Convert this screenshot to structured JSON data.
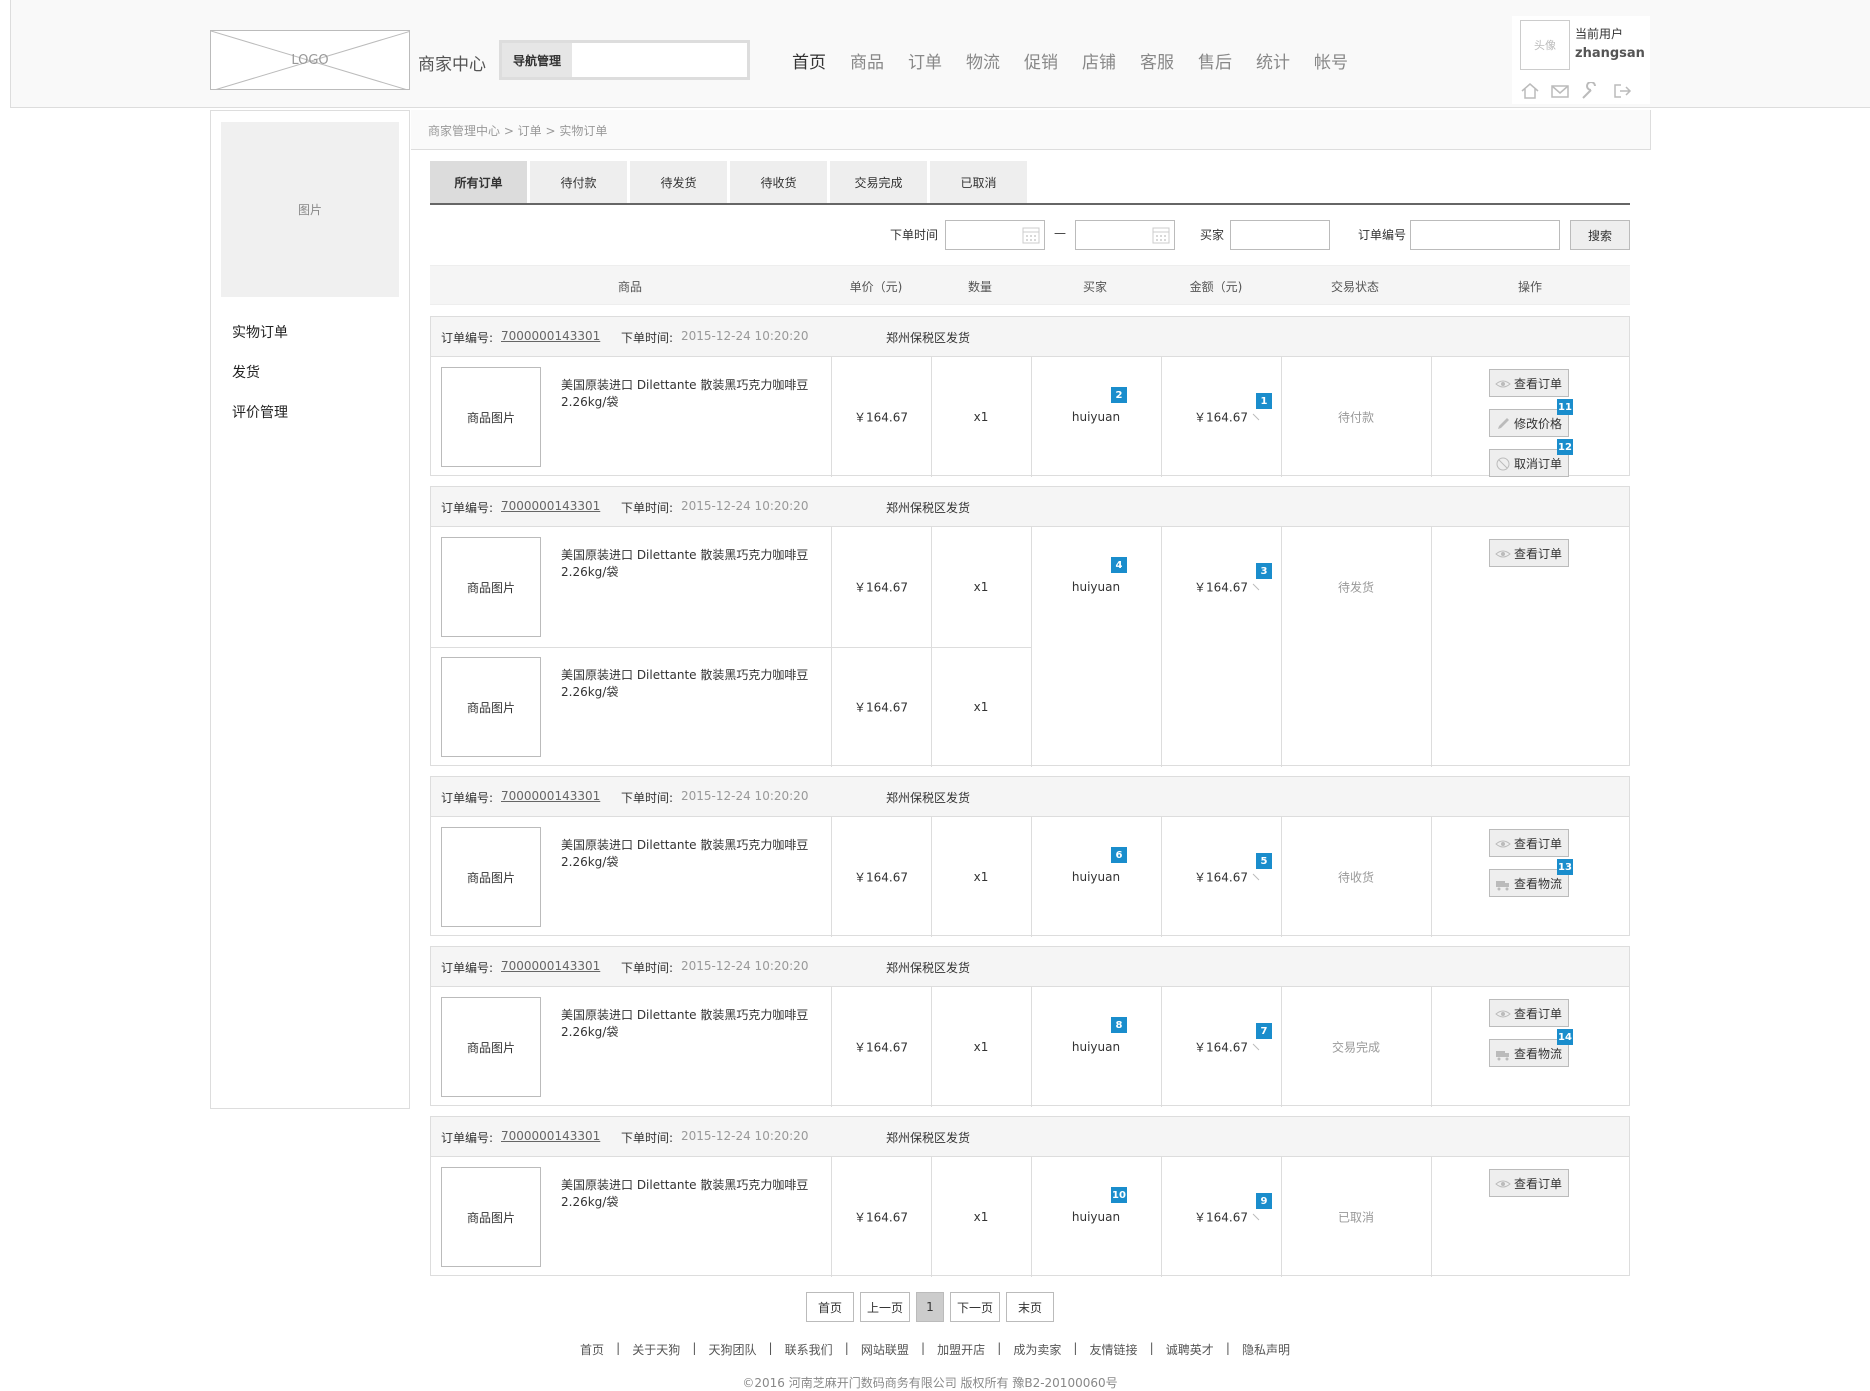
{
  "header": {
    "logo_text": "LOGO",
    "center_title": "商家中心",
    "nav_manage_label": "导航管理",
    "nav_items": [
      "首页",
      "商品",
      "订单",
      "物流",
      "促销",
      "店铺",
      "客服",
      "售后",
      "统计",
      "帐号"
    ],
    "avatar_text": "头像",
    "current_user_label": "当前用户",
    "username": "zhangsan"
  },
  "sidebar": {
    "picture_label": "图片",
    "items": [
      "实物订单",
      "发货",
      "评价管理"
    ]
  },
  "breadcrumb": "商家管理中心  > 订单 > 实物订单",
  "tabs": [
    "所有订单",
    "待付款",
    "待发货",
    "待收货",
    "交易完成",
    "已取消"
  ],
  "filter": {
    "order_time_label": "下单时间",
    "dash": "—",
    "buyer_label": "买家",
    "order_no_label": "订单编号",
    "search_label": "搜索"
  },
  "table_headers": [
    "商品",
    "单价（元)",
    "数量",
    "买家",
    "金额（元)",
    "交易状态",
    "操作"
  ],
  "order_labels": {
    "no_label": "订单编号:",
    "time_label": "下单时间:",
    "product_image": "商品图片"
  },
  "orders": [
    {
      "no": "7000000143301",
      "time": "2015-12-24 10:20:20",
      "warehouse": "郑州保税区发货",
      "products": [
        {
          "name1": "美国原装进口 Dilettante 散装黑巧克力咖啡豆",
          "name2": "2.26kg/袋",
          "price": "￥164.67",
          "qty": "x1"
        }
      ],
      "buyer": "huiyuan",
      "amount": "￥164.67",
      "status": "待付款",
      "buyer_badge": "2",
      "amount_badge": "1",
      "actions": [
        {
          "label": "查看订单",
          "icon": "eye-icon",
          "badge": ""
        },
        {
          "label": "修改价格",
          "icon": "pencil-icon",
          "badge": "11"
        },
        {
          "label": "取消订单",
          "icon": "cancel-icon",
          "badge": "12"
        }
      ]
    },
    {
      "no": "7000000143301",
      "time": "2015-12-24 10:20:20",
      "warehouse": "郑州保税区发货",
      "products": [
        {
          "name1": "美国原装进口 Dilettante 散装黑巧克力咖啡豆",
          "name2": "2.26kg/袋",
          "price": "￥164.67",
          "qty": "x1"
        },
        {
          "name1": "美国原装进口 Dilettante 散装黑巧克力咖啡豆",
          "name2": "2.26kg/袋",
          "price": "￥164.67",
          "qty": "x1"
        }
      ],
      "buyer": "huiyuan",
      "amount": "￥164.67",
      "status": "待发货",
      "buyer_badge": "4",
      "amount_badge": "3",
      "actions": [
        {
          "label": "查看订单",
          "icon": "eye-icon",
          "badge": ""
        }
      ]
    },
    {
      "no": "7000000143301",
      "time": "2015-12-24 10:20:20",
      "warehouse": "郑州保税区发货",
      "products": [
        {
          "name1": "美国原装进口 Dilettante 散装黑巧克力咖啡豆",
          "name2": "2.26kg/袋",
          "price": "￥164.67",
          "qty": "x1"
        }
      ],
      "buyer": "huiyuan",
      "amount": "￥164.67",
      "status": "待收货",
      "buyer_badge": "6",
      "amount_badge": "5",
      "actions": [
        {
          "label": "查看订单",
          "icon": "eye-icon",
          "badge": ""
        },
        {
          "label": "查看物流",
          "icon": "truck-icon",
          "badge": "13"
        }
      ]
    },
    {
      "no": "7000000143301",
      "time": "2015-12-24 10:20:20",
      "warehouse": "郑州保税区发货",
      "products": [
        {
          "name1": "美国原装进口 Dilettante 散装黑巧克力咖啡豆",
          "name2": "2.26kg/袋",
          "price": "￥164.67",
          "qty": "x1"
        }
      ],
      "buyer": "huiyuan",
      "amount": "￥164.67",
      "status": "交易完成",
      "buyer_badge": "8",
      "amount_badge": "7",
      "actions": [
        {
          "label": "查看订单",
          "icon": "eye-icon",
          "badge": ""
        },
        {
          "label": "查看物流",
          "icon": "truck-icon",
          "badge": "14"
        }
      ]
    },
    {
      "no": "7000000143301",
      "time": "2015-12-24 10:20:20",
      "warehouse": "郑州保税区发货",
      "products": [
        {
          "name1": "美国原装进口 Dilettante 散装黑巧克力咖啡豆",
          "name2": "2.26kg/袋",
          "price": "￥164.67",
          "qty": "x1"
        }
      ],
      "buyer": "huiyuan",
      "amount": "￥164.67",
      "status": "已取消",
      "buyer_badge": "10",
      "amount_badge": "9",
      "actions": [
        {
          "label": "查看订单",
          "icon": "eye-icon",
          "badge": ""
        }
      ]
    }
  ],
  "pager": [
    "首页",
    "上一页",
    "1",
    "下一页",
    "末页"
  ],
  "footer": {
    "links": [
      "首页",
      "|",
      "关于天狗",
      "|",
      "天狗团队",
      "|",
      "联系我们",
      "|",
      "网站联盟",
      "|",
      "加盟开店",
      "|",
      "成为卖家",
      "|",
      "友情链接",
      "|",
      "诚聘英才",
      "|",
      "隐私声明"
    ],
    "copyright": "©2016 河南芝麻开门数码商务有限公司 版权所有 豫B2-20100060号"
  },
  "colors": {
    "badge": "#1a8dcc",
    "border": "#dddddd",
    "header_bg": "#f9f9f9"
  }
}
